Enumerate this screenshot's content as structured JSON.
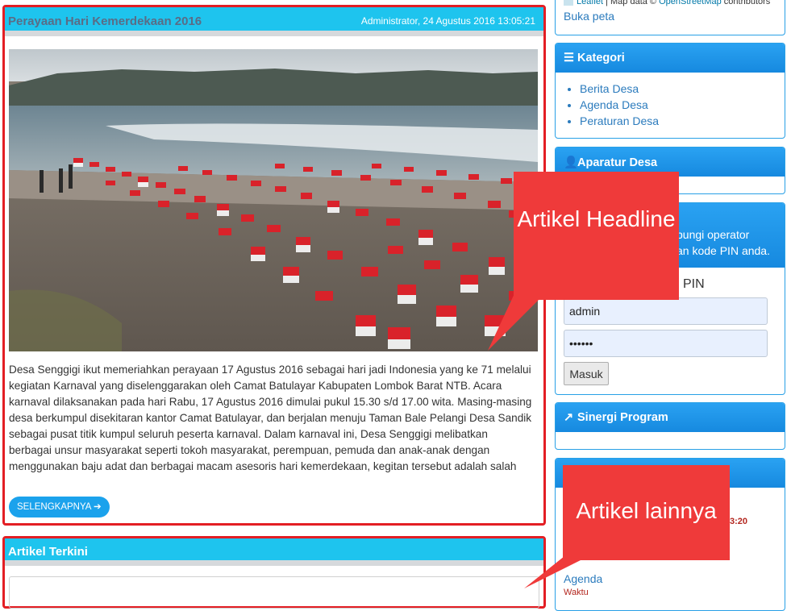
{
  "headline": {
    "title": "Perayaan Hari Kemerdekaan 2016",
    "meta": "Administrator, 24 Agustus 2016 13:05:21",
    "body": "Desa Senggigi ikut memeriahkan perayaan 17 Agustus 2016 sebagai hari jadi Indonesia yang ke 71 melalui kegiatan Karnaval yang diselenggarakan oleh Camat Batulayar Kabupaten Lombok Barat NTB. Acara karnaval dilaksanakan pada hari Rabu, 17 Agustus 2016 dimulai pukul 15.30 s/d 17.00 wita. Masing-masing desa berkumpul disekitaran kantor Camat Batulayar, dan berjalan menuju Taman Bale Pelangi Desa Sandik sebagai pusat titik kumpul seluruh peserta karnaval.    Dalam karnaval ini, Desa Senggigi melibatkan berbagai unsur masyarakat seperti tokoh masyarakat, perempuan, pemuda dan anak-anak dengan menggunakan baju adat dan berbagai macam asesoris hari kemerdekaan, kegitan tersebut adalah salah",
    "more_label": "SELENGKAPNYA"
  },
  "recent": {
    "title": "Artikel Terkini"
  },
  "sidebar": {
    "map": {
      "leaflet": "Leaflet",
      "attribution_mid": " | Map data © ",
      "osm": "OpenStreetMap",
      "attribution_end": " contributors",
      "open_map": "Buka peta"
    },
    "kategori": {
      "title": "Kategori",
      "items": [
        "Berita Desa",
        "Agenda Desa",
        "Peraturan Desa"
      ]
    },
    "aparatur": {
      "title": "Aparatur Desa"
    },
    "pin": {
      "info_line1": "bungi operator",
      "info_line2": "an kode PIN anda.",
      "label": "PIN",
      "username": "admin",
      "password": "••••••",
      "submit": "Masuk"
    },
    "sinergi": {
      "title": "Sinergi Program"
    },
    "agenda": {
      "time_fragment": "3:20",
      "link": "Agenda",
      "sub": "Waktu"
    }
  },
  "callouts": {
    "headline": "Artikel Headline",
    "lainnya": "Artikel lainnya"
  },
  "colors": {
    "panel_header": "#1ec4ee",
    "highlight_border": "#e31e24",
    "widget_header": "#1689df",
    "callout": "#ef3a3a"
  }
}
